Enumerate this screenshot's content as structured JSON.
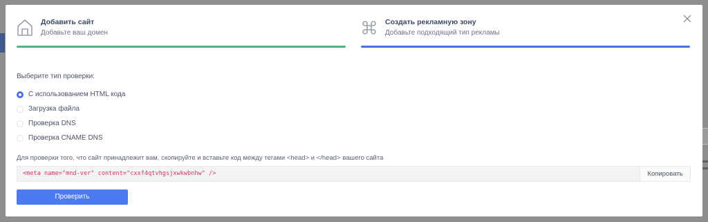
{
  "steps": [
    {
      "title": "Добавить сайт",
      "subtitle": "Добавьте ваш домен",
      "icon": "home-icon"
    },
    {
      "title": "Создать рекламную зону",
      "subtitle": "Добавьте подходящий тип рекламы",
      "icon": "command-icon"
    }
  ],
  "verification": {
    "label": "Выберите тип проверки:",
    "options": [
      {
        "label": "С использованием HTML кода",
        "selected": true
      },
      {
        "label": "Загрузка файла",
        "selected": false
      },
      {
        "label": "Проверка DNS",
        "selected": false
      },
      {
        "label": "Проверка CNAME DNS",
        "selected": false
      }
    ]
  },
  "instruction": "Для проверки того, что сайт принадлежит вам, скопируйте и вставьте код между тегами <head> и </head> вашего сайта",
  "code": {
    "value": "<meta name=\"mnd-ver\" content=\"cxxf4qtvhgsjxwkwbnhw\" />",
    "copy_label": "Копировать"
  },
  "verify_button": "Проверить",
  "colors": {
    "step1_bar": "#47b881",
    "step2_bar": "#4c6fe6",
    "primary": "#4c7af0",
    "code_text": "#d6336c"
  },
  "close_icon": "close-icon"
}
